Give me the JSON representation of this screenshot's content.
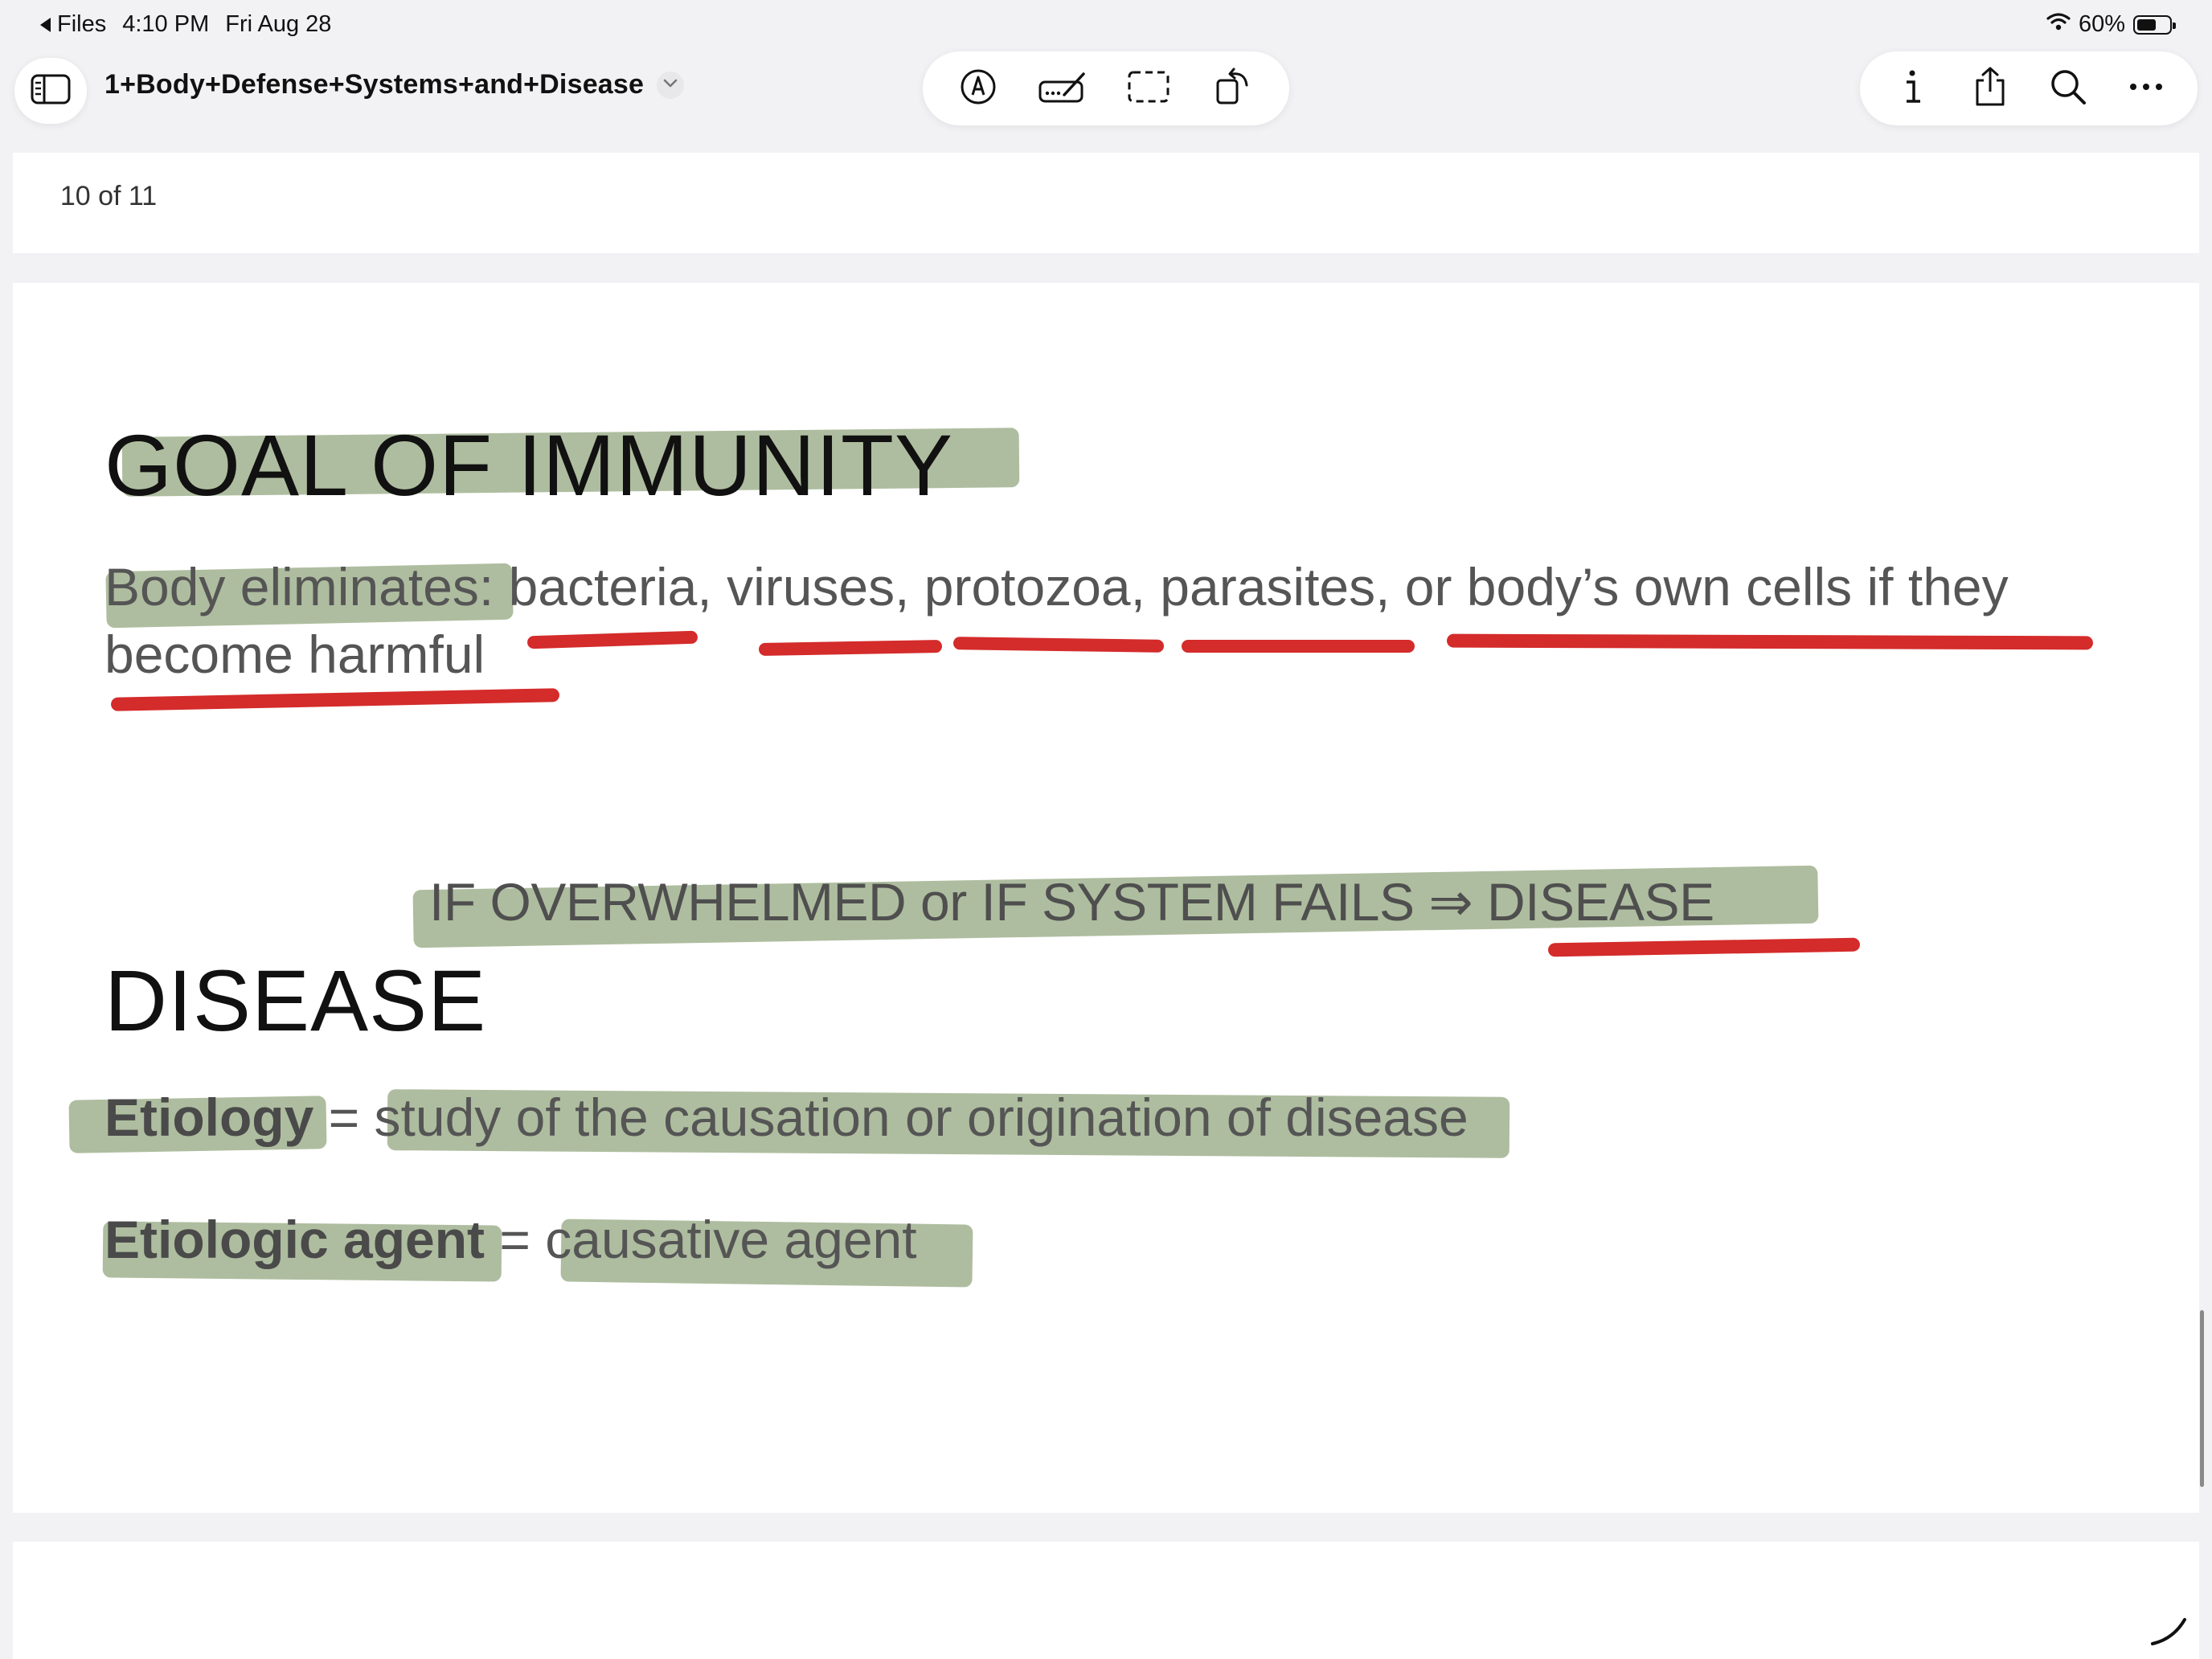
{
  "status_bar": {
    "back_label": "Files",
    "time": "4:10 PM",
    "date": "Fri Aug 28",
    "battery_percent": "60%",
    "battery_level": 0.6
  },
  "toolbar": {
    "document_title": "1+Body+Defense+Systems+and+Disease",
    "icons": [
      "sidebar-icon",
      "markup-pen-icon",
      "text-signature-icon",
      "selection-icon",
      "rotate-icon",
      "info-icon",
      "share-icon",
      "search-icon",
      "more-icon"
    ]
  },
  "page_indicator": "10 of 11",
  "slide": {
    "heading1": "GOAL OF IMMUNITY",
    "body_line1_prefix": "Body eliminates:",
    "body_line1_rest": " bacteria, viruses, protozoa, parasites, or body’s own cells if they",
    "body_line2": "become harmful",
    "callout": "IF OVERWHELMED or IF SYSTEM FAILS ⇒ DISEASE",
    "heading2": "DISEASE",
    "def1_term": "Etiology",
    "def1_eq": " = ",
    "def1_def": "study of the causation or origination of disease",
    "def2_term": "Etiologic agent",
    "def2_eq": " = ",
    "def2_def": "causative agent"
  },
  "colors": {
    "highlight_green": "#8fa47a",
    "underline_red": "#d42b2b"
  }
}
